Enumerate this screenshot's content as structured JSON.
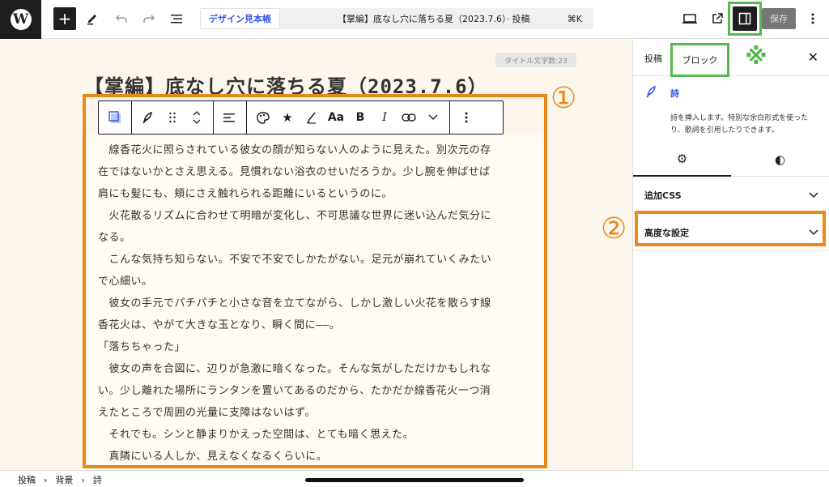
{
  "topbar": {
    "site_name": "デザイン見本帳",
    "document_title": "【掌編】底なし穴に落ちる夏（2023.7.6）· 投稿",
    "shortcut": "⌘K",
    "save_label": "保存"
  },
  "editor": {
    "title_count": "タイトル文字数:23",
    "post_title": "【掌編】底なし穴に落ちる夏（2023.7.6）",
    "annotation_1": "①",
    "poem_lines": [
      "　線香花火に照らされている彼女の顔が知らない人のように見えた。別次元の存",
      "在ではないかとさえ思える。見慣れない浴衣のせいだろうか。少し腕を伸ばせば",
      "肩にも髪にも、頬にさえ触れられる距離にいるというのに。",
      "　火花散るリズムに合わせて明暗が変化し、不可思議な世界に迷い込んだ気分に",
      "なる。",
      "　こんな気持ち知らない。不安で不安でしかたがない。足元が崩れていくみたい",
      "で心細い。",
      "　彼女の手元でパチパチと小さな音を立てながら、しかし激しい火花を散らす線",
      "香花火は、やがて大きな玉となり、瞬く間に――。",
      "「落ちちゃった」",
      "　彼女の声を合図に、辺りが急激に暗くなった。そんな気がしただけかもしれな",
      "い。少し離れた場所にランタンを置いてあるのだから、たかだか線香花火一つ消",
      "えたところで周囲の光量に支障はないはず。",
      "　それでも。シンと静まりかえった空間は、とても暗く思えた。",
      "　真隣にいる人しか、見えなくなるくらいに。"
    ],
    "toolbar_text": {
      "format": "Aa",
      "bold": "B",
      "italic": "I"
    }
  },
  "sidebar": {
    "tab_post": "投稿",
    "tab_block": "ブロック",
    "green_mark": "※",
    "block_name": "詩",
    "block_desc": "詩を挿入します。特別な余白形式を使ったり、歌詞を引用したりできます。",
    "panels": [
      "追加CSS",
      "高度な設定"
    ],
    "annotation_2": "②"
  },
  "footer": {
    "breadcrumbs": [
      "投稿",
      "背景",
      "詩"
    ]
  },
  "colors": {
    "accent": "#3858e9",
    "annotation_orange": "#e8891b",
    "annotation_green": "#55b84a",
    "canvas_bg": "#fdf6ec"
  }
}
